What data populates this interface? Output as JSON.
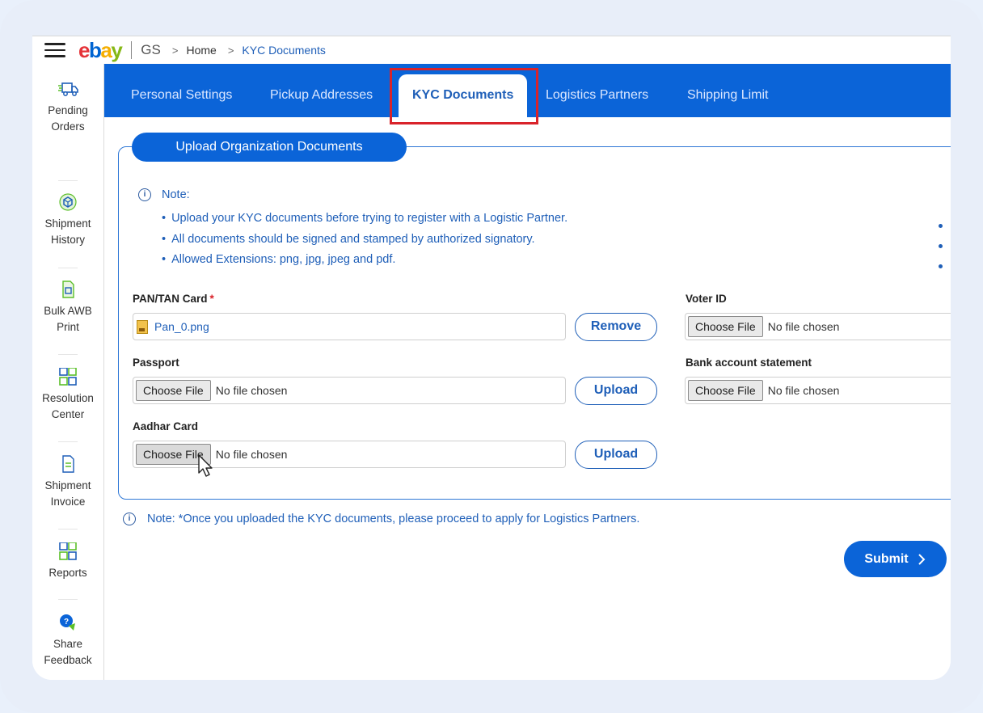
{
  "header": {
    "logo_e": "e",
    "logo_b": "b",
    "logo_a": "a",
    "logo_y": "y",
    "org": "GS",
    "breadcrumb": [
      "Home",
      "KYC Documents"
    ]
  },
  "sidebar": {
    "items": [
      {
        "label": "Pending\nOrders",
        "icon": "truck-icon"
      },
      {
        "label": "Shipment\nHistory",
        "icon": "box-icon"
      },
      {
        "label": "Bulk AWB\nPrint",
        "icon": "document-icon"
      },
      {
        "label": "Resolution\nCenter",
        "icon": "grid-icon"
      },
      {
        "label": "Shipment\nInvoice",
        "icon": "invoice-icon"
      },
      {
        "label": "Reports",
        "icon": "grid-icon"
      },
      {
        "label": "Share\nFeedback",
        "icon": "chat-icon"
      }
    ]
  },
  "tabs": [
    "Personal Settings",
    "Pickup Addresses",
    "KYC Documents",
    "Logistics Partners",
    "Shipping Limit"
  ],
  "active_tab": "KYC Documents",
  "section": {
    "title": "Upload Organization Documents",
    "note_title": "Note:",
    "notes": [
      "Upload your KYC documents before trying to register with a Logistic Partner.",
      "All documents should be signed and stamped by authorized signatory.",
      "Allowed Extensions: png, jpg, jpeg and pdf."
    ],
    "fields": {
      "pan": {
        "label": "PAN/TAN Card",
        "required": "*",
        "file": "Pan_0.png",
        "action": "Remove"
      },
      "passport": {
        "label": "Passport",
        "choose": "Choose File",
        "status": "No file chosen",
        "action": "Upload"
      },
      "aadhar": {
        "label": "Aadhar Card",
        "choose": "Choose File",
        "status": "No file chosen",
        "action": "Upload"
      },
      "voter": {
        "label": "Voter ID",
        "choose": "Choose File",
        "status": "No file chosen"
      },
      "bank": {
        "label": "Bank account statement",
        "choose": "Choose File",
        "status": "No file chosen"
      }
    }
  },
  "footer_note": "Note: *Once you uploaded the KYC documents, please proceed to apply for Logistics Partners.",
  "submit_label": "Submit",
  "colors": {
    "primary": "#0b64d8",
    "link": "#1f5fb8",
    "highlight": "#d9232a"
  }
}
